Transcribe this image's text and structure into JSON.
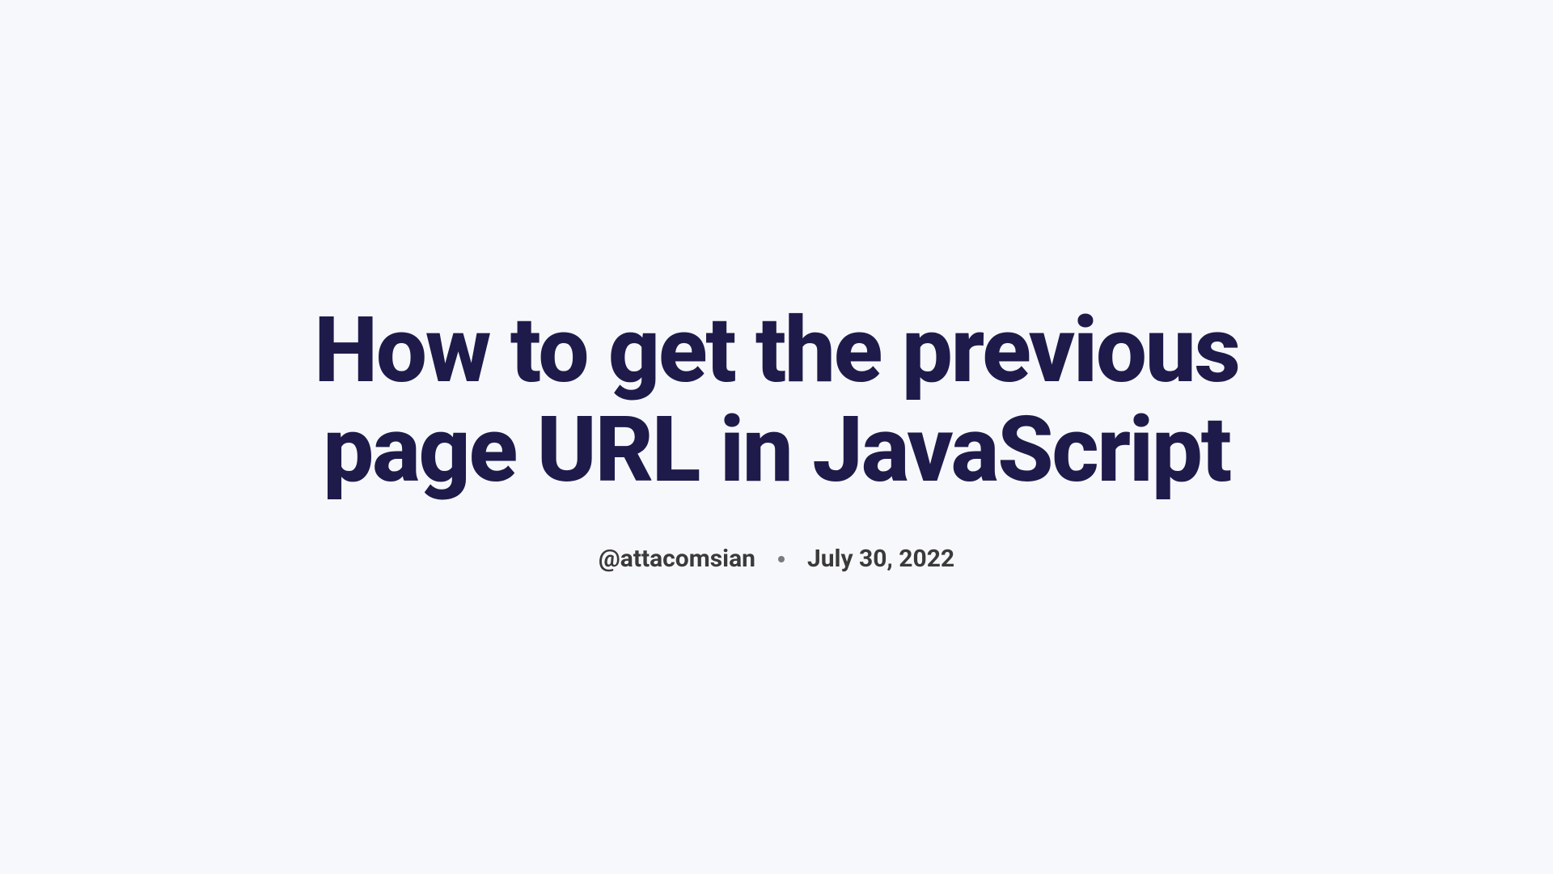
{
  "title": "How to get the previous page URL in JavaScript",
  "meta": {
    "author": "@attacomsian",
    "date": "July 30, 2022"
  }
}
